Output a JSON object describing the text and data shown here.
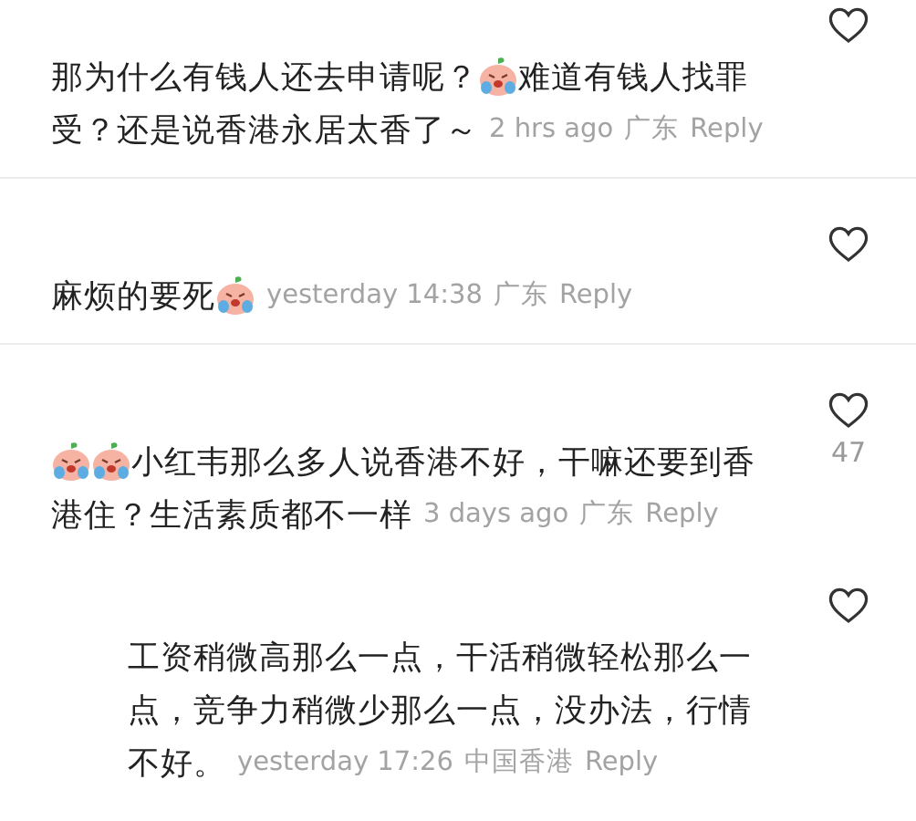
{
  "comments": [
    {
      "lines": [
        [
          {
            "kind": "text",
            "text": "那为什么有钱人还去申请呢？ "
          },
          {
            "kind": "sticker"
          },
          {
            "kind": "text",
            "text": "难道有钱人找罪"
          }
        ],
        [
          {
            "kind": "text",
            "text": "受？还是说香港永居太香了～"
          }
        ]
      ],
      "time": "2 hrs ago",
      "location": "广东",
      "reply": "Reply"
    },
    {
      "lines": [
        [
          {
            "kind": "text",
            "text": "麻烦的要死"
          },
          {
            "kind": "sticker"
          }
        ]
      ],
      "time": "yesterday 14:38",
      "location": "广东",
      "reply": "Reply"
    },
    {
      "lines": [
        [
          {
            "kind": "sticker"
          },
          {
            "kind": "sticker"
          },
          {
            "kind": "text",
            "text": "小红韦那么多人说香港不好，干嘛还要到香"
          }
        ],
        [
          {
            "kind": "text",
            "text": "港住？生活素质都不一样"
          }
        ]
      ],
      "time": "3 days ago",
      "location": "广东",
      "reply": "Reply",
      "likes": "47",
      "children": [
        {
          "lines": [
            [
              {
                "kind": "text",
                "text": "工资稍微高那么一点，干活稍微轻松那么一"
              }
            ],
            [
              {
                "kind": "text",
                "text": "点，竞争力稍微少那么一点，没办法，行情"
              }
            ],
            [
              {
                "kind": "text",
                "text": "不好。"
              }
            ]
          ],
          "time": "yesterday 17:26",
          "location": "中国香港",
          "reply": "Reply"
        }
      ]
    }
  ]
}
